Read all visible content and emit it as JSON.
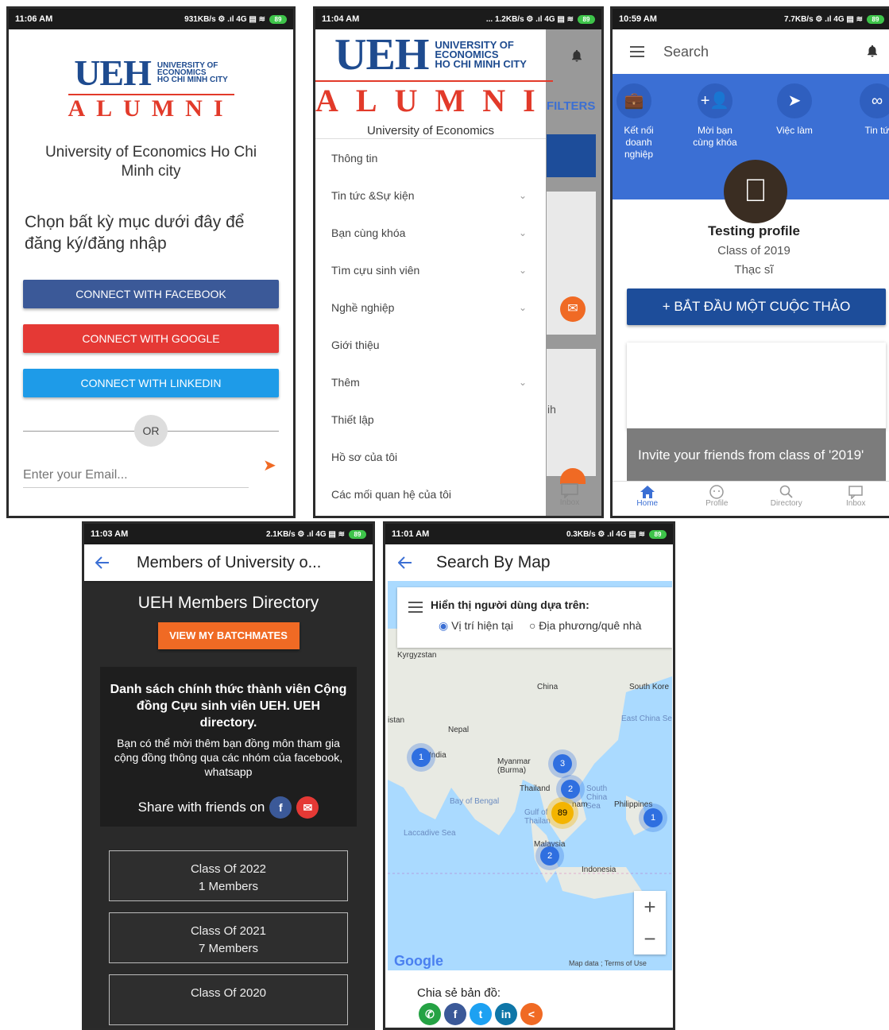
{
  "colors": {
    "brand_blue": "#1e4b8f",
    "brand_red": "#e23a2a",
    "facebook": "#3b5998",
    "google": "#e53935",
    "linkedin": "#1e9be8",
    "accent_orange": "#f06a24",
    "primary_blue": "#3b6fd4"
  },
  "screen1": {
    "status": {
      "time": "11:06 AM",
      "net": "931KB/s ⚙ .ıl 4G ▤ ≋",
      "battery": "89"
    },
    "logo": {
      "ueh": "UEH",
      "line1": "UNIVERSITY OF",
      "line2": "ECONOMICS",
      "line3": "HO CHI MINH CITY",
      "alumni": "ALUMNI"
    },
    "university": "University of Economics Ho Chi Minh city",
    "prompt": "Chọn bất kỳ mục dưới đây để đăng ký/đăng nhập",
    "facebook_btn": "CONNECT WITH FACEBOOK",
    "google_btn": "CONNECT WITH GOOGLE",
    "linkedin_btn": "CONNECT WITH LINKEDIN",
    "or_label": "OR",
    "email_placeholder": "Enter your Email..."
  },
  "screen2": {
    "status": {
      "time": "11:04 AM",
      "net": "... 1.2KB/s ⚙ .ıl 4G ▤ ≋",
      "battery": "89"
    },
    "logo": {
      "ueh": "UEH",
      "line1": "UNIVERSITY OF",
      "line2": "ECONOMICS",
      "line3": "HO CHI MINH CITY",
      "alumni": "ALUMNI",
      "tagline": "University of Economics"
    },
    "filters_label": "FILTERS",
    "partial_text": "ih",
    "inbox_label": "Inbox",
    "menu": [
      {
        "label": "Thông tin",
        "expandable": false
      },
      {
        "label": "Tin tức &Sự kiện",
        "expandable": true
      },
      {
        "label": "Bạn cùng khóa",
        "expandable": true
      },
      {
        "label": "Tìm cựu sinh viên",
        "expandable": true
      },
      {
        "label": "Nghề nghiệp",
        "expandable": true
      },
      {
        "label": "Giới thiệu",
        "expandable": false
      },
      {
        "label": "Thêm",
        "expandable": true
      },
      {
        "label": "Thiết lập",
        "expandable": false
      },
      {
        "label": "Hồ sơ của tôi",
        "expandable": false
      },
      {
        "label": "Các mối quan hệ của tôi",
        "expandable": false
      }
    ]
  },
  "screen3": {
    "status": {
      "time": "10:59 AM",
      "net": "7.7KB/s ⚙ .ıl 4G ▤ ≋",
      "battery": "89"
    },
    "search_label": "Search",
    "quick_actions": [
      {
        "icon": "briefcase-icon",
        "label": "Kết nối doanh nghiệp"
      },
      {
        "icon": "add-friend-icon",
        "label": "Mời bạn cùng khóa"
      },
      {
        "icon": "paper-plane-icon",
        "label": "Việc làm"
      },
      {
        "icon": "infinity-icon",
        "label": "Tin tứ"
      }
    ],
    "profile": {
      "name": "Testing profile",
      "class": "Class of 2019",
      "degree": "Thạc sĩ"
    },
    "start_discussion": "+ BẮT ĐẦU MỘT CUỘC THẢO",
    "invite_text": "Invite your friends from class of '2019'",
    "nav": [
      "Home",
      "Profile",
      "Directory",
      "Inbox"
    ]
  },
  "screen4": {
    "status": {
      "time": "11:03 AM",
      "net": "2.1KB/s ⚙ .ıl 4G ▤ ≋",
      "battery": "89"
    },
    "title": "Members of University o...",
    "directory_heading": "UEH Members Directory",
    "batchmates_btn": "VIEW MY BATCHMATES",
    "info_heading": "Danh sách chính thức thành viên Cộng đồng Cựu sinh viên UEH. UEH directory.",
    "info_body": "Bạn có thể mời thêm bạn đồng môn tham gia cộng đồng thông qua các nhóm của facebook, whatsapp",
    "share_label": "Share with friends on",
    "classes": [
      {
        "name": "Class Of 2022",
        "members": "1 Members"
      },
      {
        "name": "Class Of 2021",
        "members": "7 Members"
      },
      {
        "name": "Class Of 2020",
        "members": ""
      }
    ]
  },
  "screen5": {
    "status": {
      "time": "11:01 AM",
      "net": "0.3KB/s ⚙ .ıl 4G ▤ ≋",
      "battery": "89"
    },
    "title": "Search By Map",
    "display_label": "Hiển thị người dùng dựa trên:",
    "radio_current": "Vị trí hiện tại",
    "radio_home": "Địa phương/quê nhà",
    "map_labels": {
      "kyrgyzstan": "Kyrgyzstan",
      "china": "China",
      "south_korea": "South Kore",
      "east_china_sea": "East China Se",
      "nepal": "Nepal",
      "india": "India",
      "myanmar": "Myanmar (Burma)",
      "thailand": "Thailand",
      "south_china_sea": "South China Sea",
      "bay_of_bengal": "Bay of Bengal",
      "gulf_of_thailand": "Gulf of Thailan",
      "vietnam": "nam",
      "philippines": "Philippines",
      "laccadive_sea": "Laccadive Sea",
      "malaysia": "Malaysia",
      "indonesia": "Indonesia",
      "stan": "istan"
    },
    "clusters": [
      {
        "count": "1",
        "type": "small"
      },
      {
        "count": "3",
        "type": "small"
      },
      {
        "count": "2",
        "type": "small"
      },
      {
        "count": "89",
        "type": "large"
      },
      {
        "count": "1",
        "type": "small"
      },
      {
        "count": "2",
        "type": "small"
      }
    ],
    "google_label": "Google",
    "terms_label": "Map data ; Terms of Use",
    "share_label": "Chia sẻ bản đồ:"
  }
}
